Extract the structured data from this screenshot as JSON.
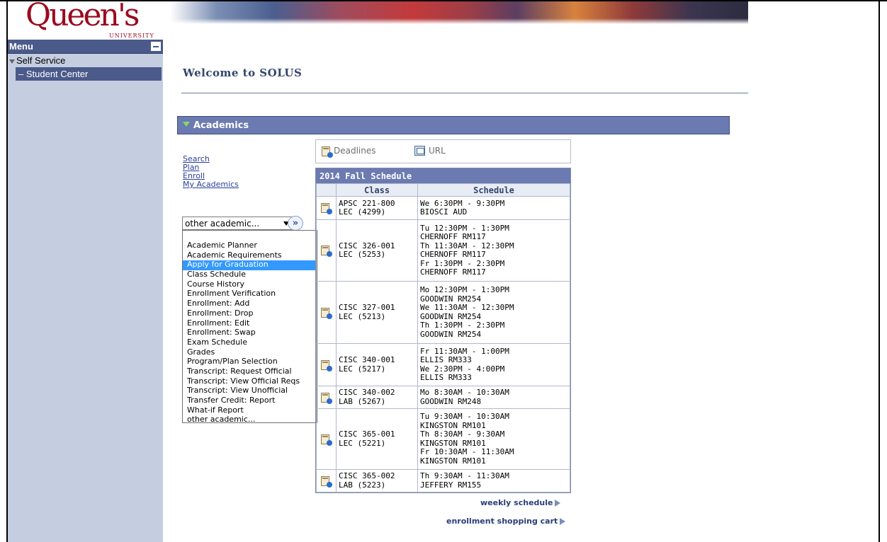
{
  "logo": {
    "word": "Queen's",
    "sub": "UNIVERSITY"
  },
  "menu": {
    "title": "Menu",
    "self_service": "Self Service",
    "student_center": "– Student Center"
  },
  "page": {
    "welcome": "Welcome to SOLUS",
    "section_title": "Academics"
  },
  "academic_links": [
    "Search",
    "Plan",
    "Enroll",
    "My Academics"
  ],
  "dropdown": {
    "selected": "other academic...",
    "go_label": "»",
    "options": [
      "Academic Planner",
      "Academic Requirements",
      "Apply for Graduation",
      "Class Schedule",
      "Course History",
      "Enrollment Verification",
      "Enrollment: Add",
      "Enrollment: Drop",
      "Enrollment: Edit",
      "Enrollment: Swap",
      "Exam Schedule",
      "Grades",
      "Program/Plan Selection",
      "Transcript: Request Official",
      "Transcript: View Official Reqs",
      "Transcript: View Unofficial",
      "Transfer Credit: Report",
      "What-if Report",
      "other academic..."
    ],
    "highlighted": "Apply for Graduation"
  },
  "toolbar": {
    "deadlines": "Deadlines",
    "url": "URL"
  },
  "schedule": {
    "title": "2014 Fall Schedule",
    "col_class": "Class",
    "col_schedule": "Schedule",
    "rows": [
      {
        "class": "APSC 221-800\nLEC (4299)",
        "schedule": "We 6:30PM - 9:30PM\nBIOSCI AUD"
      },
      {
        "class": "CISC 326-001\nLEC (5253)",
        "schedule": "Tu 12:30PM - 1:30PM\nCHERNOFF RM117\nTh 11:30AM - 12:30PM\nCHERNOFF RM117\nFr 1:30PM - 2:30PM\nCHERNOFF RM117"
      },
      {
        "class": "CISC 327-001\nLEC (5213)",
        "schedule": "Mo 12:30PM - 1:30PM\nGOODWIN RM254\nWe 11:30AM - 12:30PM\nGOODWIN RM254\nTh 1:30PM - 2:30PM\nGOODWIN RM254"
      },
      {
        "class": "CISC 340-001\nLEC (5217)",
        "schedule": "Fr 11:30AM - 1:00PM\nELLIS RM333\nWe 2:30PM - 4:00PM\nELLIS RM333"
      },
      {
        "class": "CISC 340-002\nLAB (5267)",
        "schedule": "Mo 8:30AM - 10:30AM\nGOODWIN RM248"
      },
      {
        "class": "CISC 365-001\nLEC (5221)",
        "schedule": "Tu 9:30AM - 10:30AM\nKINGSTON RM101\nTh 8:30AM - 9:30AM\nKINGSTON RM101\nFr 10:30AM - 11:30AM\nKINGSTON RM101"
      },
      {
        "class": "CISC 365-002\nLAB (5223)",
        "schedule": "Th 9:30AM - 11:30AM\nJEFFERY RM155"
      }
    ]
  },
  "links": {
    "weekly": "weekly schedule",
    "cart": "enrollment shopping cart"
  }
}
